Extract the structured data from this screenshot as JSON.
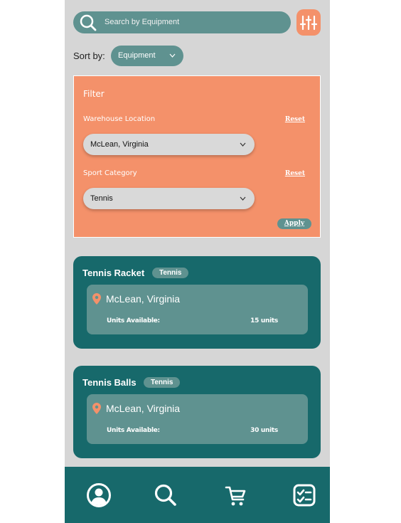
{
  "search": {
    "placeholder": "Search by Equipment"
  },
  "sort": {
    "label": "Sort by:",
    "value": "Equipment"
  },
  "filter": {
    "title": "Filter",
    "location_label": "Warehouse Location",
    "location_reset": "Reset",
    "location_value": "McLean, Virginia",
    "category_label": "Sport Category",
    "category_reset": "Reset",
    "category_value": "Tennis",
    "apply_label": "Apply"
  },
  "items": [
    {
      "name": "Tennis Racket",
      "tag": "Tennis",
      "location": "McLean, Virginia",
      "units_label": "Units Available:",
      "units": "15 units"
    },
    {
      "name": "Tennis Balls",
      "tag": "Tennis",
      "location": "McLean, Virginia",
      "units_label": "Units Available:",
      "units": "30 units"
    }
  ],
  "nav": {
    "icons": [
      "profile-icon",
      "search-icon",
      "cart-icon",
      "checklist-icon"
    ]
  },
  "colors": {
    "teal": "#17696b",
    "teal_light": "#5f9290",
    "orange": "#f4916a",
    "background": "#d6d6d6"
  }
}
